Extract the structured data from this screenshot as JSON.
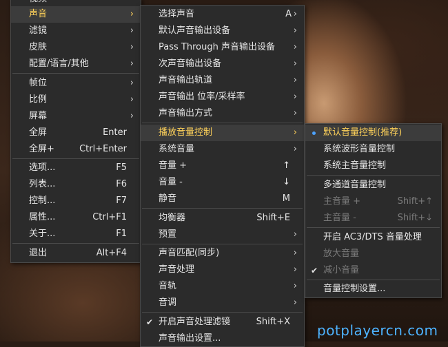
{
  "menu1": {
    "partial_top": "视频",
    "items": [
      {
        "label": "声音",
        "arrow": true,
        "highlight": true
      },
      {
        "label": "滤镜",
        "arrow": true
      },
      {
        "label": "皮肤",
        "arrow": true
      },
      {
        "label": "配置/语言/其他",
        "arrow": true
      },
      {
        "label": "帧位",
        "arrow": true
      },
      {
        "label": "比例",
        "arrow": true
      },
      {
        "label": "屏幕",
        "arrow": true
      },
      {
        "label": "全屏",
        "shortcut": "Enter"
      },
      {
        "label": "全屏+",
        "shortcut": "Ctrl+Enter"
      },
      {
        "label": "选项...",
        "shortcut": "F5"
      },
      {
        "label": "列表...",
        "shortcut": "F6"
      },
      {
        "label": "控制...",
        "shortcut": "F7"
      },
      {
        "label": "属性...",
        "shortcut": "Ctrl+F1"
      },
      {
        "label": "关于...",
        "shortcut": "F1"
      },
      {
        "label": "退出",
        "shortcut": "Alt+F4"
      }
    ]
  },
  "menu2": {
    "items": [
      {
        "label": "选择声音",
        "shortcut": "A",
        "arrow": true
      },
      {
        "label": "默认声音输出设备",
        "arrow": true
      },
      {
        "label": "Pass Through 声音输出设备",
        "arrow": true
      },
      {
        "label": "次声音输出设备",
        "arrow": true
      },
      {
        "label": "声音输出轨道",
        "arrow": true
      },
      {
        "label": "声音输出 位率/采样率",
        "arrow": true
      },
      {
        "label": "声音输出方式",
        "arrow": true
      },
      {
        "label": "播放音量控制",
        "arrow": true,
        "highlight": true
      },
      {
        "label": "系统音量",
        "arrow": true
      },
      {
        "label": "音量 +",
        "shortcut": "↑"
      },
      {
        "label": "音量 -",
        "shortcut": "↓"
      },
      {
        "label": "静音",
        "shortcut": "M"
      },
      {
        "label": "均衡器",
        "shortcut": "Shift+E"
      },
      {
        "label": "预置",
        "arrow": true
      },
      {
        "label": "声音匹配(同步)",
        "arrow": true
      },
      {
        "label": "声音处理",
        "arrow": true
      },
      {
        "label": "音轨",
        "arrow": true
      },
      {
        "label": "音调",
        "arrow": true
      },
      {
        "label": "开启声音处理滤镜",
        "shortcut": "Shift+X",
        "checked": true
      },
      {
        "label": "声音输出设置..."
      }
    ]
  },
  "menu3": {
    "items": [
      {
        "label": "默认音量控制(推荐)",
        "highlight": true,
        "radio": true
      },
      {
        "label": "系统波形音量控制"
      },
      {
        "label": "系统主音量控制"
      },
      {
        "label": "多通道音量控制"
      },
      {
        "label": "主音量 +",
        "shortcut": "Shift+↑",
        "disabled": true
      },
      {
        "label": "主音量 -",
        "shortcut": "Shift+↓",
        "disabled": true
      },
      {
        "label": "开启 AC3/DTS 音量处理"
      },
      {
        "label": "放大音量",
        "disabled": true
      },
      {
        "label": "减小音量",
        "disabled": true,
        "checked": true
      },
      {
        "label": "音量控制设置..."
      }
    ]
  },
  "watermark": "potplayercn.com",
  "colors": {
    "menu_bg": "#2b2b2b",
    "highlight_text": "#ffd25a",
    "radio_dot": "#4da3ff",
    "watermark": "#4db3ff"
  }
}
